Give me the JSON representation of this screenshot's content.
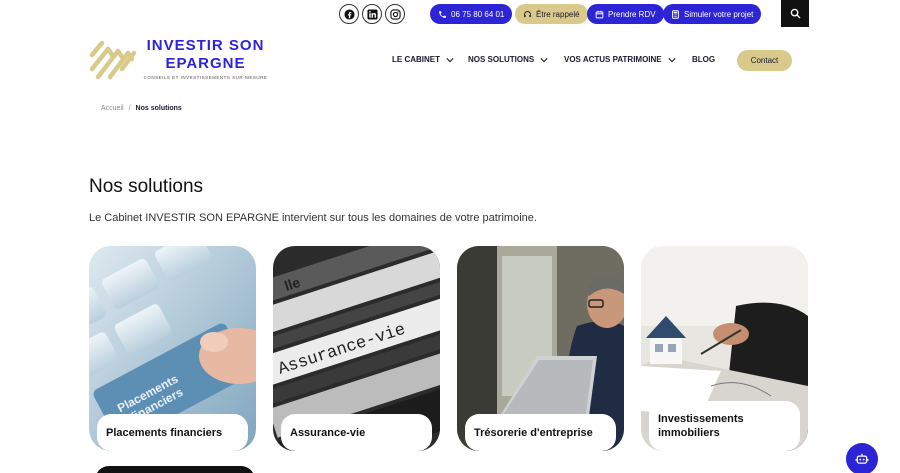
{
  "topbar": {
    "social": [
      {
        "name": "facebook"
      },
      {
        "name": "linkedin"
      },
      {
        "name": "instagram"
      }
    ],
    "phone_label": "06 75 80 64 01",
    "callback_label": "Être rappelé",
    "rdv_label": "Prendre RDV",
    "simulate_label": "Simuler votre projet"
  },
  "logo": {
    "title_line1": "INVESTIR SON",
    "title_line2": "EPARGNE",
    "subtitle": "CONSEILS ET INVESTISSEMENTS SUR-MESURE"
  },
  "nav": {
    "items": [
      {
        "label": "LE CABINET",
        "dropdown": true
      },
      {
        "label": "NOS SOLUTIONS",
        "dropdown": true
      },
      {
        "label": "VOS ACTUS PATRIMOINE",
        "dropdown": true
      },
      {
        "label": "BLOG",
        "dropdown": false
      }
    ],
    "contact_label": "Contact"
  },
  "breadcrumb": {
    "home": "Accueil",
    "separator": "/",
    "current": "Nos solutions"
  },
  "main": {
    "title": "Nos solutions",
    "intro": "Le Cabinet INVESTIR SON EPARGNE intervient sur tous les domaines de votre patrimoine."
  },
  "cards": [
    {
      "label": "Placements financiers",
      "image_text_1": "Placements",
      "image_text_2": "financiers"
    },
    {
      "label": "Assurance-vie",
      "image_text_1": "Assurance-vie",
      "image_text_2": "lle"
    },
    {
      "label": "Trésorerie d'entreprise"
    },
    {
      "label": "Investissements immobiliers"
    }
  ],
  "colors": {
    "brand_blue": "#2d24d6",
    "gold": "#d9c98a",
    "dark": "#111111"
  }
}
